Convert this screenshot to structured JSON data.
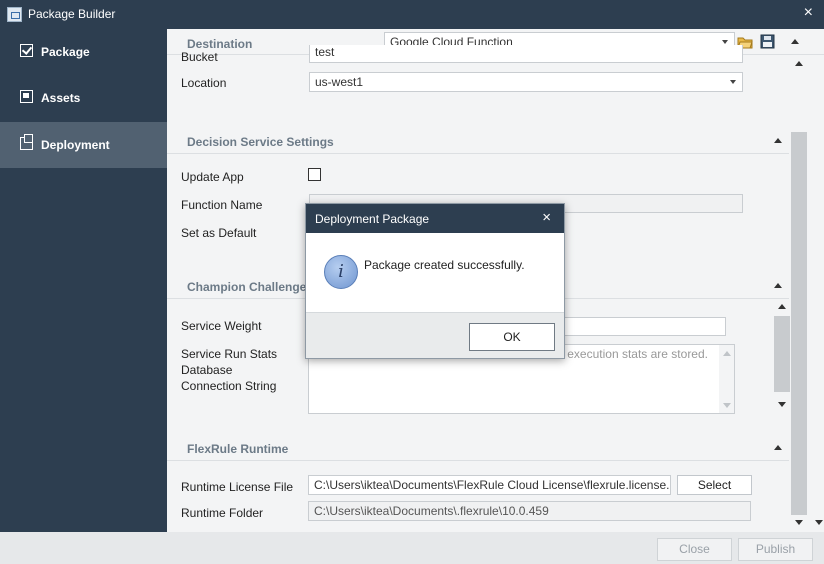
{
  "window": {
    "title": "Package Builder",
    "close": "×"
  },
  "sidebar": {
    "items": [
      {
        "label": "Package",
        "icon": "check-square-icon",
        "active": false
      },
      {
        "label": "Assets",
        "icon": "assets-icon",
        "active": false
      },
      {
        "label": "Deployment",
        "icon": "deployment-icon",
        "active": true
      }
    ]
  },
  "destination": {
    "label": "Destination",
    "selected": "Google Cloud Function",
    "icons": [
      "open-folder-icon",
      "save-icon"
    ]
  },
  "storage": {
    "bucket_label": "Bucket",
    "bucket_value": "test",
    "location_label": "Location",
    "location_value": "us-west1"
  },
  "decision_service": {
    "title": "Decision Service Settings",
    "update_app_label": "Update App",
    "update_app_checked": false,
    "function_name_label": "Function Name",
    "function_name_value": "",
    "set_default_label": "Set as Default"
  },
  "champion": {
    "title": "Champion Challenger S",
    "service_weight_label": "Service Weight",
    "service_weight_value": "",
    "run_stats_label_1": "Service Run Stats",
    "run_stats_label_2": "Database",
    "run_stats_label_3": "Connection String",
    "run_stats_placeholder": "execution stats are stored."
  },
  "runtime": {
    "title": "FlexRule Runtime",
    "license_label": "Runtime License File",
    "license_value": "C:\\Users\\iktea\\Documents\\FlexRule Cloud License\\flexrule.license.lic",
    "select_label": "Select",
    "folder_label": "Runtime Folder",
    "folder_value": "C:\\Users\\iktea\\Documents\\.flexrule\\10.0.459"
  },
  "footer": {
    "close_label": "Close",
    "publish_label": "Publish"
  },
  "dialog": {
    "title": "Deployment Package",
    "close": "×",
    "message": "Package created successfully.",
    "icon": "info-icon",
    "icon_glyph": "i",
    "ok_label": "OK"
  }
}
